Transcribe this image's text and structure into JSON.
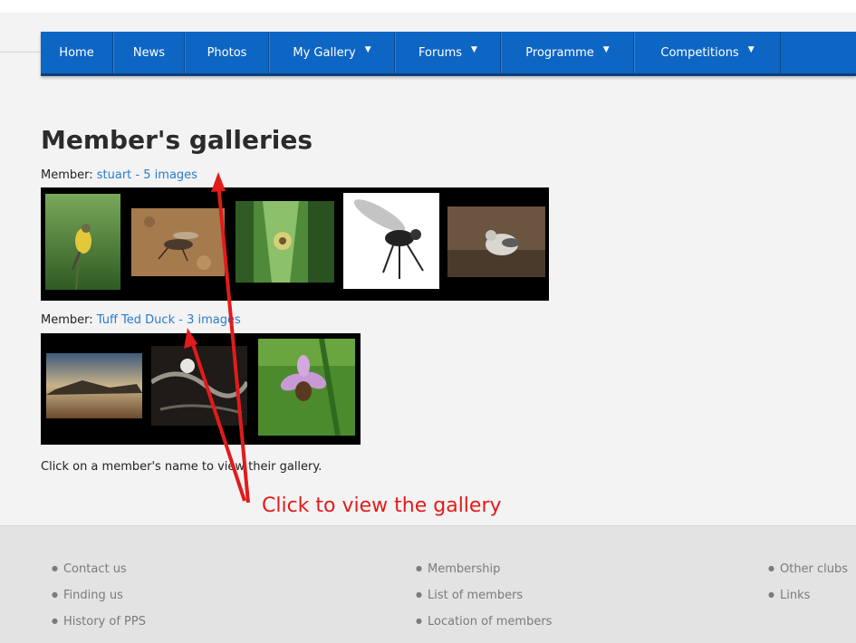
{
  "nav": {
    "items": [
      {
        "label": "Home",
        "dropdown": false
      },
      {
        "label": "News",
        "dropdown": false
      },
      {
        "label": "Photos",
        "dropdown": false
      },
      {
        "label": "My Gallery",
        "dropdown": true
      },
      {
        "label": "Forums",
        "dropdown": true
      },
      {
        "label": "Programme",
        "dropdown": true
      },
      {
        "label": "Competitions",
        "dropdown": true
      }
    ],
    "caret": "▼"
  },
  "page": {
    "title": "Member's galleries",
    "member_prefix": "Member:",
    "members": [
      {
        "name": "stuart",
        "count_text": "- 5 images"
      },
      {
        "name": "Tuff Ted Duck",
        "count_text": "- 3 images"
      }
    ],
    "help_text": "Click on a member's name to view their gallery."
  },
  "annotation": {
    "text": "Click to view the gallery",
    "color": "#e21b1b"
  },
  "footer": {
    "col1": [
      "Contact us",
      "Finding us",
      "History of PPS"
    ],
    "col2": [
      "Membership",
      "List of members",
      "Location of members"
    ],
    "col3": [
      "Other clubs",
      "Links"
    ]
  },
  "colors": {
    "nav_bg": "#0e66c4",
    "link": "#2a7bd1",
    "page_bg": "#f3f3f3",
    "footer_bg": "#e3e3e3"
  }
}
